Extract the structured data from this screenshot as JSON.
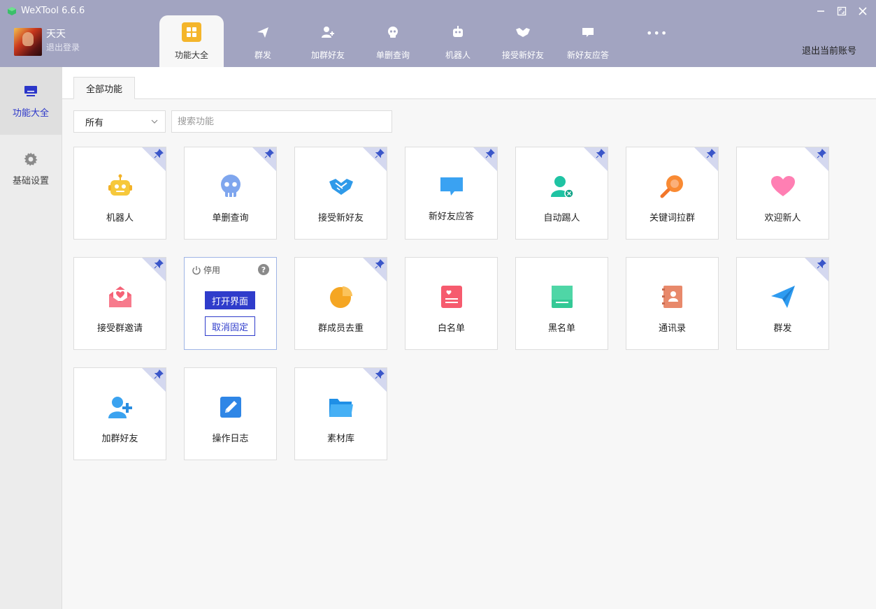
{
  "app": {
    "title": "WeXTool 6.6.6"
  },
  "user": {
    "name": "天天",
    "logout": "退出登录"
  },
  "nav": {
    "tabs": [
      {
        "label": "功能大全",
        "icon": "apps-grid-icon"
      },
      {
        "label": "群发",
        "icon": "send-plane-icon"
      },
      {
        "label": "加群好友",
        "icon": "add-user-icon"
      },
      {
        "label": "单删查询",
        "icon": "skull-icon"
      },
      {
        "label": "机器人",
        "icon": "robot-icon"
      },
      {
        "label": "接受新好友",
        "icon": "handshake-icon"
      },
      {
        "label": "新好友应答",
        "icon": "chat-bubble-icon"
      }
    ],
    "more": "•••",
    "logout_account": "退出当前账号"
  },
  "sidebar": {
    "items": [
      {
        "label": "功能大全",
        "icon": "monitor-icon"
      },
      {
        "label": "基础设置",
        "icon": "gear-icon"
      }
    ]
  },
  "content": {
    "tab_label": "全部功能",
    "filter_value": "所有",
    "search_placeholder": "搜索功能",
    "cards": [
      {
        "label": "机器人",
        "icon": "robot-icon"
      },
      {
        "label": "单删查询",
        "icon": "skull-icon"
      },
      {
        "label": "接受新好友",
        "icon": "handshake-icon"
      },
      {
        "label": "新好友应答",
        "icon": "chat-bubble-icon"
      },
      {
        "label": "自动踢人",
        "icon": "user-remove-icon"
      },
      {
        "label": "关键词拉群",
        "icon": "search-magnifier-icon"
      },
      {
        "label": "欢迎新人",
        "icon": "heart-icon"
      },
      {
        "label": "接受群邀请",
        "icon": "envelope-heart-icon"
      },
      {
        "label": "群成员去重",
        "icon": "pie-chart-icon"
      },
      {
        "label": "白名单",
        "icon": "whitelist-icon"
      },
      {
        "label": "黑名单",
        "icon": "blacklist-icon"
      },
      {
        "label": "通讯录",
        "icon": "contacts-book-icon"
      },
      {
        "label": "群发",
        "icon": "send-plane-icon"
      },
      {
        "label": "加群好友",
        "icon": "add-user-icon"
      },
      {
        "label": "操作日志",
        "icon": "edit-log-icon"
      },
      {
        "label": "素材库",
        "icon": "folder-icon"
      }
    ],
    "expanded_card": {
      "disable_label": "停用",
      "help": "?",
      "open_button": "打开界面",
      "unpin_button": "取消固定"
    }
  },
  "colors": {
    "header_bg": "#a2a4c1",
    "accent": "#2f3ccb",
    "active_tab_icon_bg": "#f4b52b"
  }
}
